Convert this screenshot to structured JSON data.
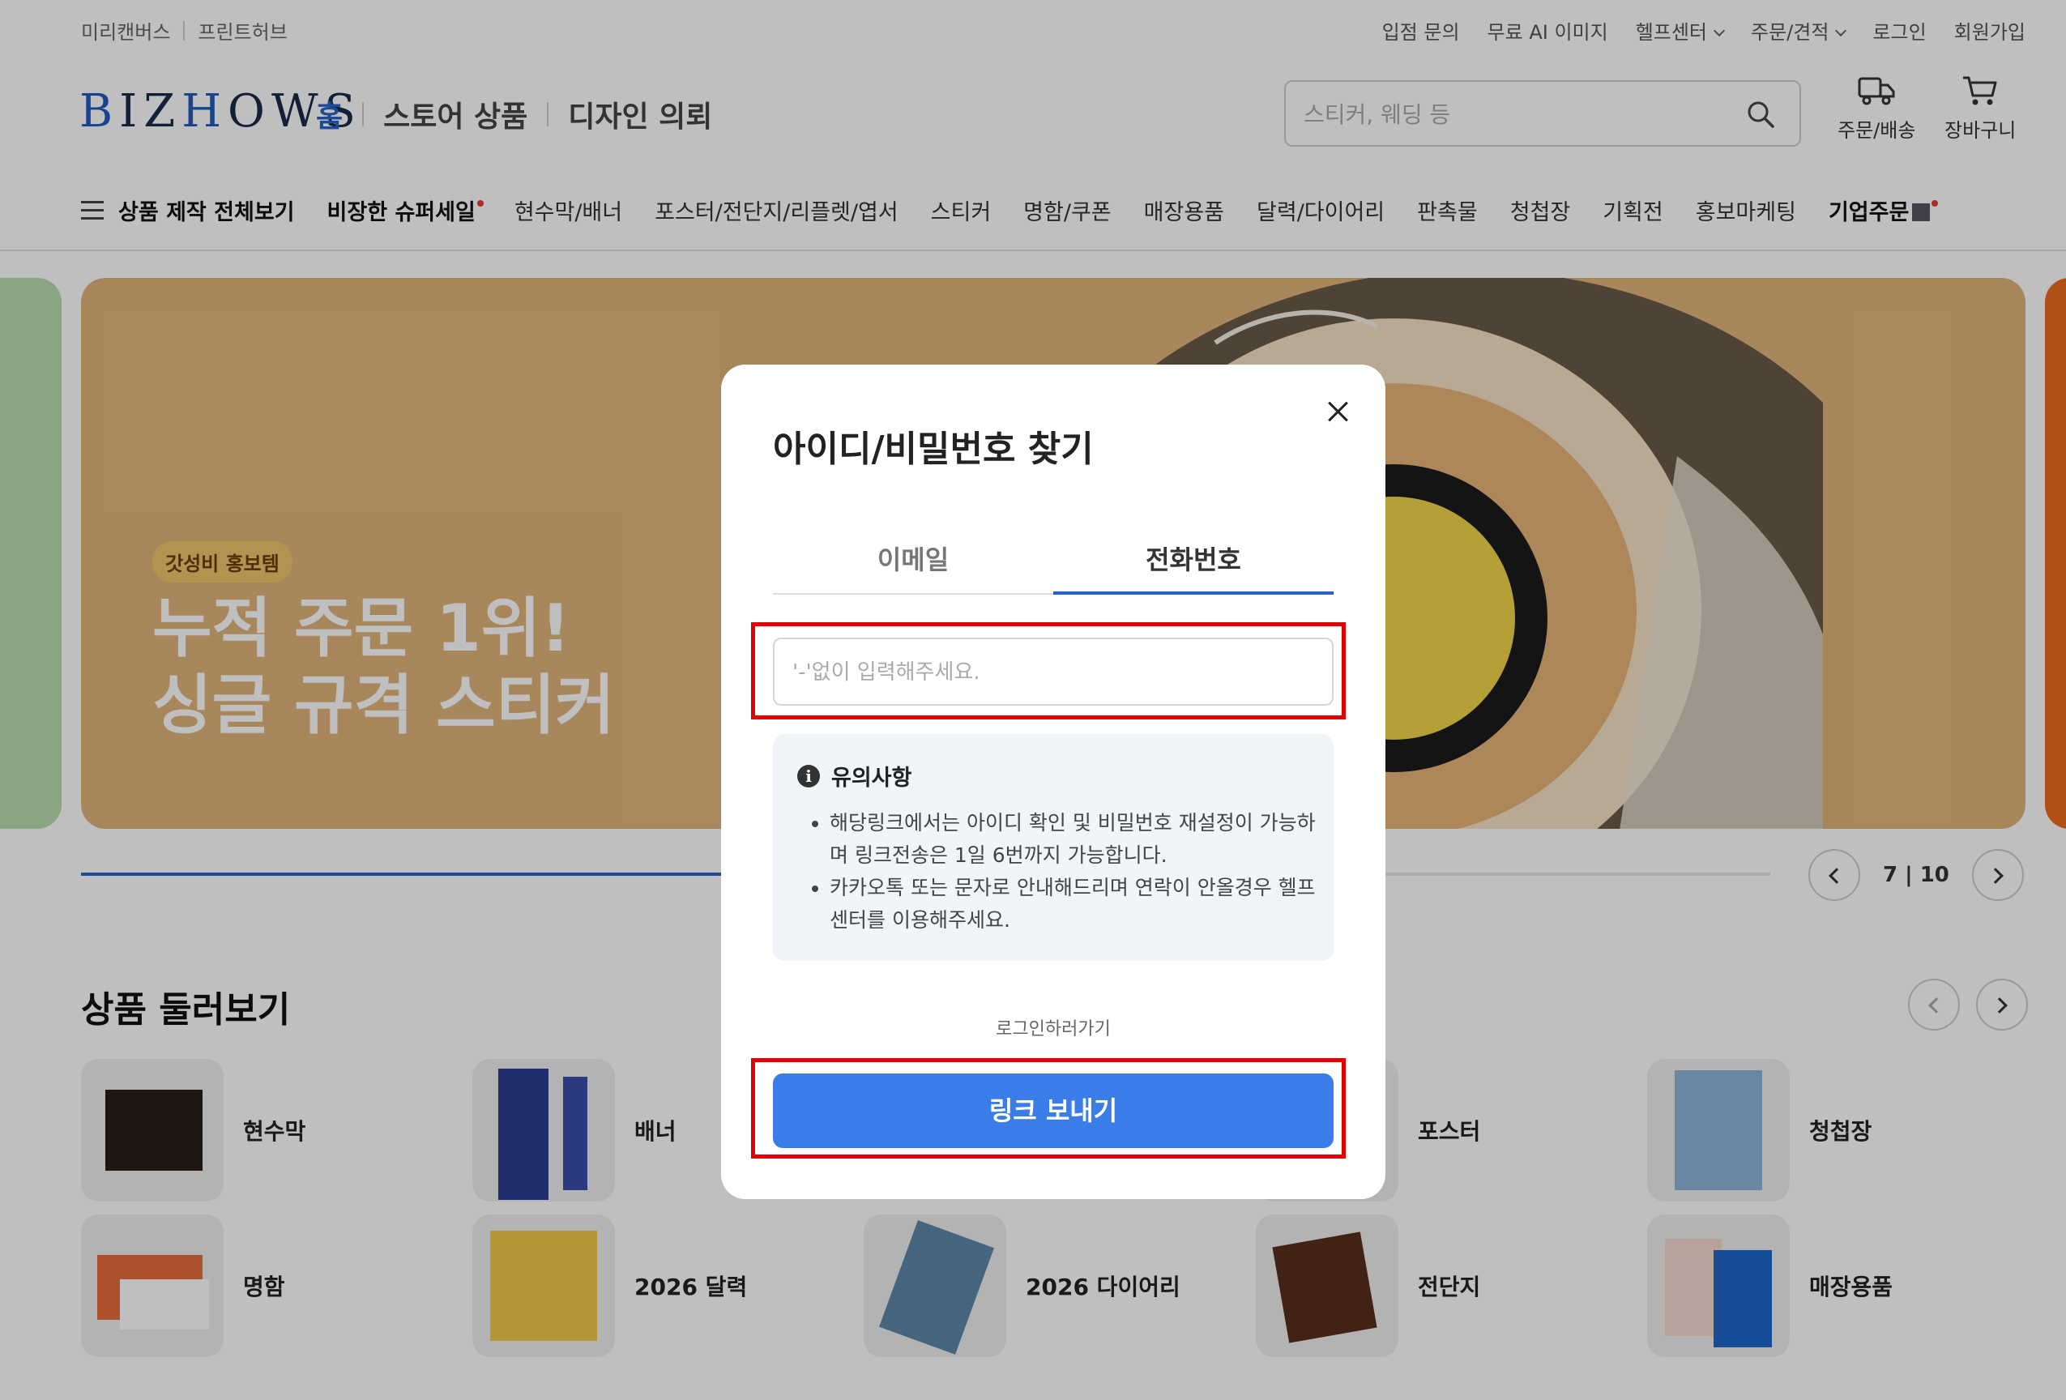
{
  "util": {
    "left": [
      "미리캔버스",
      "프린트허브"
    ],
    "right": [
      "입점 문의",
      "무료 AI 이미지",
      "헬프센터",
      "주문/견적",
      "로그인",
      "회원가입"
    ]
  },
  "header": {
    "logo": "BIZHOWS",
    "nav": [
      "홈",
      "스토어 상품",
      "디자인 의뢰"
    ],
    "search_placeholder": "스티커, 웨딩 등",
    "orders_label": "주문/배송",
    "cart_label": "장바구니"
  },
  "catnav": {
    "all": "상품 제작 전체보기",
    "items": [
      "비장한 슈퍼세일",
      "현수막/배너",
      "포스터/전단지/리플렛/엽서",
      "스티커",
      "명함/쿠폰",
      "매장용품",
      "달력/다이어리",
      "판촉물",
      "청첩장",
      "기획전",
      "홍보마케팅",
      "기업주문"
    ]
  },
  "hero": {
    "badge": "갓성비 홍보템",
    "title_line1": "누적 주문 1위!",
    "title_line2": "싱글 규격 스티커",
    "progress": 0.7,
    "page": "7 | 10",
    "colors": {
      "background": "#e2b57c",
      "left_peek": "#b9dcae",
      "right_peek": "#ee6a1f"
    }
  },
  "products": {
    "title": "상품 둘러보기",
    "items": [
      "현수막",
      "배너",
      "포스터",
      "청첩장",
      "명함",
      "2026 달력",
      "2026 다이어리",
      "전단지",
      "매장용품"
    ]
  },
  "modal": {
    "title": "아이디/비밀번호 찾기",
    "tabs": [
      "이메일",
      "전화번호"
    ],
    "active_tab": "전화번호",
    "phone_placeholder": "'-'없이 입력해주세요.",
    "notice_title": "유의사항",
    "notices": [
      "해당링크에서는 아이디 확인 및 비밀번호 재설정이 가능하며 링크전송은 1일 6번까지 가능합니다.",
      "카카오톡 또는 문자로 안내해드리며 연락이 안올경우 헬프센터를 이용해주세요."
    ],
    "login_link": "로그인하러가기",
    "send_button": "링크 보내기",
    "accent_color": "#3a7ce8",
    "highlight_color": "#e40000"
  }
}
